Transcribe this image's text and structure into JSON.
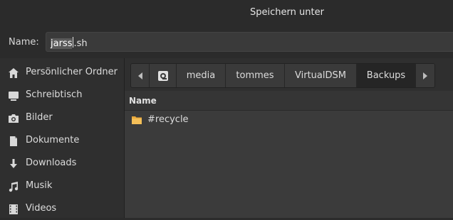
{
  "window": {
    "title": "Speichern unter"
  },
  "name_field": {
    "label": "Name:",
    "value_selected": "jarss",
    "value_rest": ".sh"
  },
  "sidebar": {
    "items": [
      {
        "label": "Persönlicher Ordner",
        "icon": "home-icon"
      },
      {
        "label": "Schreibtisch",
        "icon": "desktop-icon"
      },
      {
        "label": "Bilder",
        "icon": "camera-icon"
      },
      {
        "label": "Dokumente",
        "icon": "document-icon"
      },
      {
        "label": "Downloads",
        "icon": "download-icon"
      },
      {
        "label": "Musik",
        "icon": "music-icon"
      },
      {
        "label": "Videos",
        "icon": "video-icon"
      }
    ]
  },
  "pathbar": {
    "crumbs": [
      "media",
      "tommes",
      "VirtualDSM",
      "Backups"
    ],
    "active": "Backups"
  },
  "file_list": {
    "column_name": "Name",
    "rows": [
      {
        "name": "#recycle",
        "icon": "folder-icon"
      }
    ]
  },
  "colors": {
    "folder": "#f0b74a",
    "background": "#2b2b2b",
    "list_bg": "#3b3b3b"
  }
}
